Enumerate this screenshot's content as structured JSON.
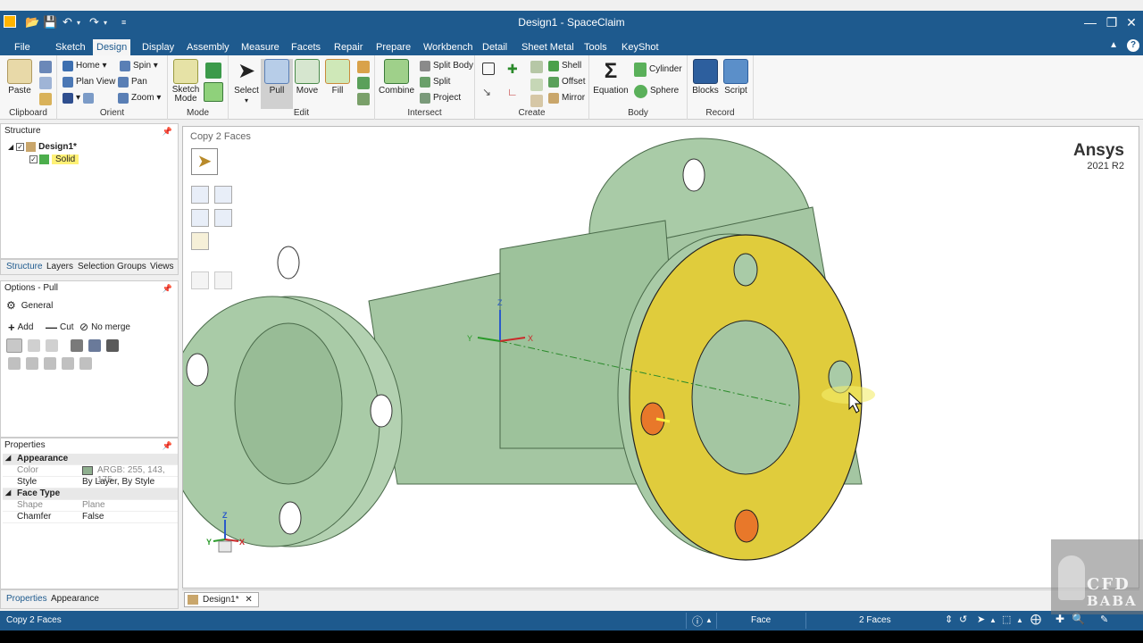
{
  "window": {
    "title": "Design1 - SpaceClaim"
  },
  "menu_tabs": [
    {
      "label": "File"
    },
    {
      "label": "Sketch"
    },
    {
      "label": "Design"
    },
    {
      "label": "Display"
    },
    {
      "label": "Assembly"
    },
    {
      "label": "Measure"
    },
    {
      "label": "Facets"
    },
    {
      "label": "Repair"
    },
    {
      "label": "Prepare"
    },
    {
      "label": "Workbench"
    },
    {
      "label": "Detail"
    },
    {
      "label": "Sheet Metal"
    },
    {
      "label": "Tools"
    },
    {
      "label": "KeyShot"
    }
  ],
  "ribbon": {
    "clipboard": {
      "label": "Clipboard",
      "paste": "Paste"
    },
    "orient": {
      "label": "Orient",
      "home": "Home",
      "spin": "Spin",
      "plan_view": "Plan View",
      "pan": "Pan",
      "zoom": "Zoom"
    },
    "mode": {
      "label": "Mode",
      "sketch_mode": "Sketch Mode"
    },
    "edit": {
      "label": "Edit",
      "select": "Select",
      "pull": "Pull",
      "move": "Move",
      "fill": "Fill"
    },
    "intersect": {
      "label": "Intersect",
      "combine": "Combine",
      "split_body": "Split Body",
      "split": "Split",
      "project": "Project"
    },
    "create": {
      "label": "Create",
      "shell": "Shell",
      "offset": "Offset",
      "mirror": "Mirror"
    },
    "body": {
      "label": "Body",
      "equation": "Equation",
      "cylinder": "Cylinder",
      "sphere": "Sphere"
    },
    "record": {
      "label": "Record",
      "blocks": "Blocks",
      "script": "Script"
    }
  },
  "structure": {
    "title": "Structure",
    "root": "Design1*",
    "child": "Solid"
  },
  "panel_tabs": [
    {
      "label": "Structure"
    },
    {
      "label": "Layers"
    },
    {
      "label": "Selection"
    },
    {
      "label": "Groups"
    },
    {
      "label": "Views"
    }
  ],
  "options": {
    "title": "Options - Pull",
    "general": "General",
    "add": "Add",
    "cut": "Cut",
    "no_merge": "No merge"
  },
  "properties": {
    "title": "Properties",
    "appearance_header": "Appearance",
    "color_key": "Color",
    "color_value": "ARGB: 255, 143, 175",
    "style_key": "Style",
    "style_value": "By Layer, By Style",
    "face_type_header": "Face Type",
    "shape_key": "Shape",
    "shape_value": "Plane",
    "chamfer_key": "Chamfer",
    "chamfer_value": "False"
  },
  "bottom_tabs": [
    {
      "label": "Properties"
    },
    {
      "label": "Appearance"
    }
  ],
  "viewport": {
    "hint": "Copy 2 Faces",
    "brand_name": "Ansys",
    "brand_version": "2021 R2",
    "axis_z": "Z",
    "axis_y": "Y",
    "axis_x": "X"
  },
  "doc_tab": {
    "label": "Design1*"
  },
  "status": {
    "message": "Copy 2 Faces",
    "selection_type": "Face",
    "selection_count": "2 Faces"
  },
  "watermark": {
    "line1": "CFD",
    "line2": "BABA"
  },
  "colors": {
    "title_bar": "#1e5a8e",
    "body_green": "#a9cba7",
    "selected_face": "#e0cc3c",
    "hole_orange": "#e8782a"
  }
}
